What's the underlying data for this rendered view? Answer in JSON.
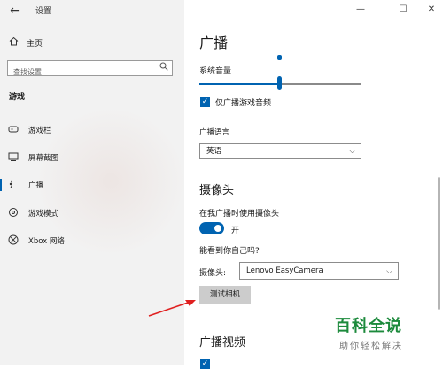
{
  "window": {
    "title": "设置",
    "minimize": "—",
    "maximize": "☐",
    "close": "✕"
  },
  "sidebar": {
    "home": "主页",
    "search_placeholder": "查找设置",
    "section": "游戏",
    "items": [
      {
        "label": "游戏栏",
        "icon": "game-bar-icon"
      },
      {
        "label": "屏幕截图",
        "icon": "screenshot-icon"
      },
      {
        "label": "广播",
        "icon": "broadcast-icon"
      },
      {
        "label": "游戏模式",
        "icon": "game-mode-icon"
      },
      {
        "label": "Xbox 网络",
        "icon": "xbox-icon"
      }
    ],
    "active_index": 2
  },
  "main": {
    "title": "广播",
    "system_volume_label": "系统音量",
    "system_volume_level": 0.5,
    "game_audio_only_label": "仅广播游戏音频",
    "broadcast_language_label": "广播语言",
    "broadcast_language_value": "英语",
    "camera_heading": "摄像头",
    "use_camera_label": "在我广播时使用摄像头",
    "camera_toggle_state": "开",
    "see_yourself_label": "能看到你自己吗?",
    "camera_select_label": "摄像头:",
    "camera_select_value": "Lenovo EasyCamera",
    "test_camera_button": "测试相机",
    "video_heading": "广播视频"
  },
  "watermark": {
    "title": "百科全说",
    "subtitle": "助你轻松解决"
  },
  "colors": {
    "accent": "#0063b1",
    "sidebar_bg": "#f2f2f2",
    "arrow": "#e02020",
    "watermark": "#1c8a3c"
  }
}
